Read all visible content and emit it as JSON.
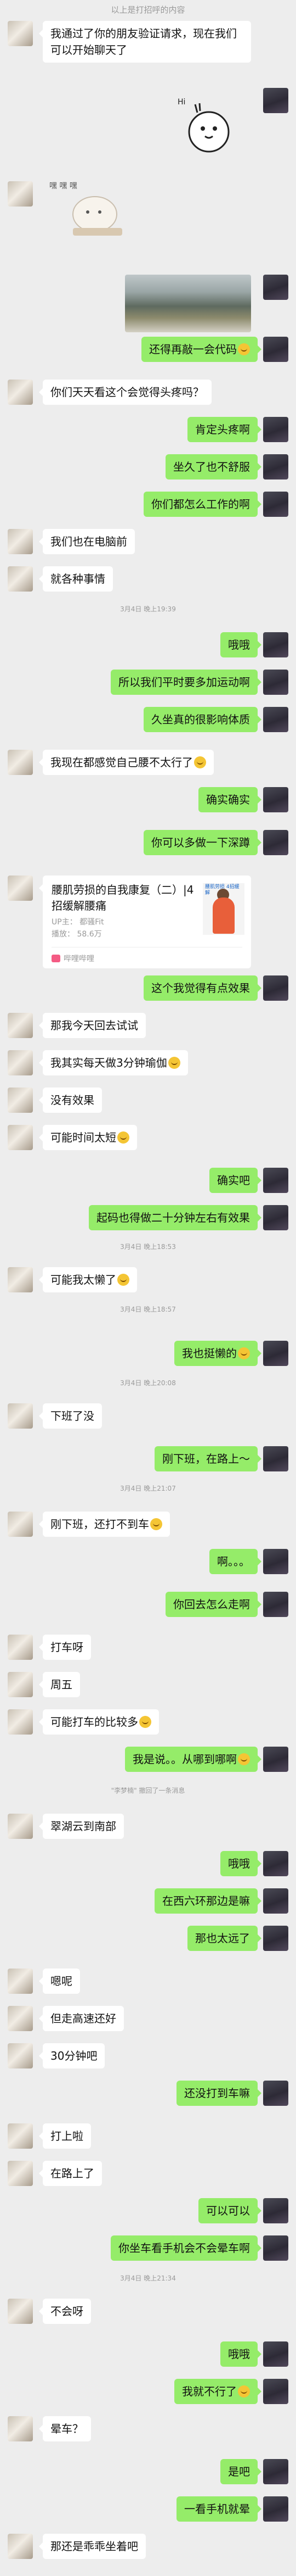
{
  "top_notice": "以上是打招呼的内容",
  "system": {
    "t1": "3月4日 晚上19:39",
    "t2": "3月4日 晚上18:53",
    "t3": "3月4日 晚上18:57",
    "t4": "3月4日 晚上20:08",
    "t5": "3月4日 晚上21:07",
    "recall": "\"李梦楠\" 撤回了一条消息",
    "t6": "3月4日 晚上21:34"
  },
  "sticker_caption": "嘿 嘿 嘿",
  "link_card": {
    "title": "腰肌劳损的自我康复（二）|4招缓解腰痛",
    "up": "UP主：  都骚Fit",
    "plays": "播放：  58.6万",
    "thumb_text": "腰肌劳损 4招缓解",
    "app": "哔哩哔哩"
  },
  "messages": {
    "m1": "我通过了你的朋友验证请求，现在我们可以开始聊天了",
    "m2": "还得再敲一会代码",
    "m3": "你们天天看这个会觉得头疼吗？",
    "m4": "肯定头疼啊",
    "m5": "坐久了也不舒服",
    "m6": "你们都怎么工作的啊",
    "m7": "我们也在电脑前",
    "m8": "就各种事情",
    "m9": "哦哦",
    "m10": "所以我们平时要多加运动啊",
    "m11": "久坐真的很影响体质",
    "m12": "我现在都感觉自己腰不太行了",
    "m13": "确实确实",
    "m14": "你可以多做一下深蹲",
    "m15": "这个我觉得有点效果",
    "m16": "那我今天回去试试",
    "m17": "我其实每天做3分钟瑜伽",
    "m18": "没有效果",
    "m19": "可能时间太短",
    "m20": "确实吧",
    "m21": "起码也得做二十分钟左右有效果",
    "m22": "可能我太懒了",
    "m23": "我也挺懒的",
    "m24": "下班了没",
    "m25": "刚下班，在路上～",
    "m26": "刚下班，还打不到车",
    "m27": "啊。。。",
    "m28": "你回去怎么走啊",
    "m29": "打车呀",
    "m30": "周五",
    "m31": "可能打车的比较多",
    "m32": "我是说。。从哪到哪啊",
    "m33": "翠湖云到南部",
    "m34": "哦哦",
    "m35": "在西六环那边是嘛",
    "m36": "那也太远了",
    "m37": "嗯呢",
    "m38": "但走高速还好",
    "m39": "30分钟吧",
    "m40": "还没打到车嘛",
    "m41": "打上啦",
    "m42": "在路上了",
    "m43": "可以可以",
    "m44": "你坐车看手机会不会晕车啊",
    "m45": "不会呀",
    "m46": "哦哦",
    "m47": "我就不行了",
    "m48": "晕车？",
    "m49": "是吧",
    "m50": "一看手机就晕",
    "m51": "那还是乖乖坐着吧"
  },
  "colors": {
    "background": "#ededed",
    "bubble_self": "#95ec69",
    "bubble_other": "#ffffff",
    "system_text": "#9a9a9a"
  },
  "icons": {
    "emoji": "smile-emoji-icon",
    "card_app": "bilibili-icon"
  }
}
